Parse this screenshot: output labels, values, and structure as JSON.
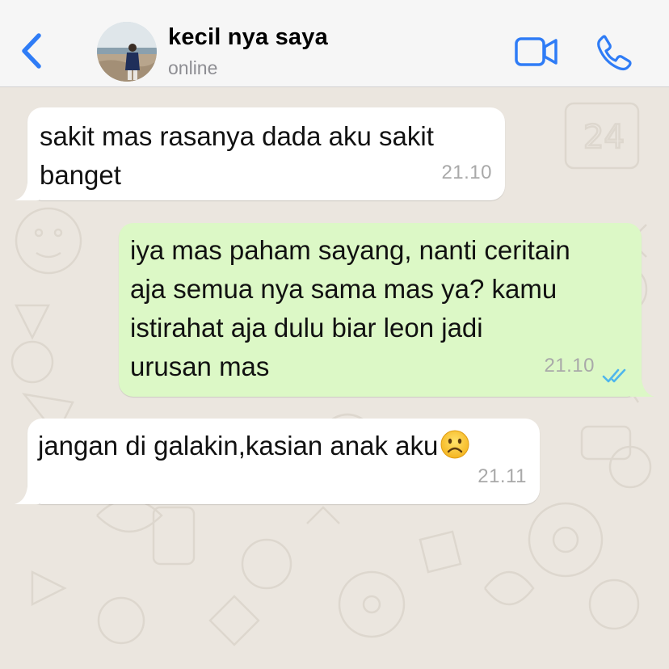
{
  "header": {
    "contact_name": "kecil nya saya",
    "status": "online",
    "icons": [
      "chevron-left-icon",
      "avatar-photo",
      "video-call-icon",
      "phone-call-icon"
    ]
  },
  "messages": [
    {
      "direction": "incoming",
      "text": "sakit mas rasanya dada aku sakit\nbanget",
      "time": "21.10"
    },
    {
      "direction": "outgoing",
      "text": "iya mas paham sayang, nanti ceritain\naja semua nya sama mas ya? kamu\nistirahat aja dulu biar leon jadi\nurusan mas",
      "time": "21.10",
      "status_icon": "double-check-read-icon"
    },
    {
      "direction": "incoming",
      "text": "jangan di galakin,kasian anak aku",
      "emoji": "frowning-face-emoji",
      "time": "21.11"
    }
  ],
  "colors": {
    "accent": "#2f7cf6",
    "incoming_bubble": "#ffffff",
    "outgoing_bubble": "#dcf8c6",
    "read_ticks": "#4fb6ec",
    "chat_background": "#ebe6df"
  }
}
